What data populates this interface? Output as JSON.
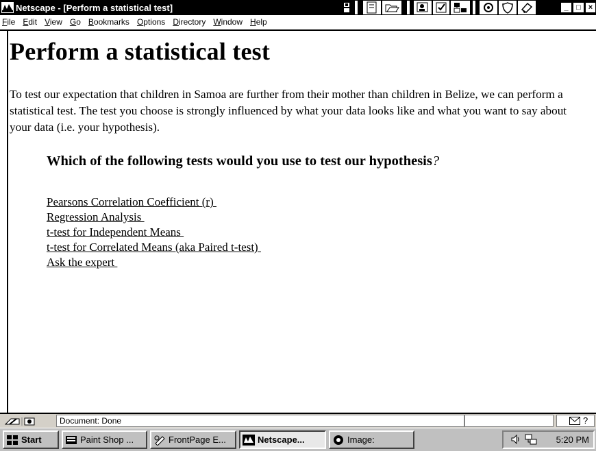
{
  "window": {
    "title": "Netscape - [Perform a statistical test]",
    "min_glyph": "_",
    "max_glyph": "□",
    "close_glyph": "×"
  },
  "menu": [
    {
      "accel": "F",
      "rest": "ile"
    },
    {
      "accel": "E",
      "rest": "dit"
    },
    {
      "accel": "V",
      "rest": "iew"
    },
    {
      "accel": "G",
      "rest": "o"
    },
    {
      "accel": "B",
      "rest": "ookmarks"
    },
    {
      "accel": "O",
      "rest": "ptions"
    },
    {
      "accel": "D",
      "rest": "irectory"
    },
    {
      "accel": "W",
      "rest": "indow"
    },
    {
      "accel": "H",
      "rest": "elp"
    }
  ],
  "page": {
    "title": "Perform a statistical test",
    "intro": "To test our expectation that children in Samoa are further from their mother than children in Belize, we can perform a statistical test. The test you choose is strongly influenced by what your data looks like and what you want to say about your data (i.e. your hypothesis).",
    "question": "Which of the following tests would you use to test our hypothesis",
    "question_mark": "?",
    "options": [
      "Pearsons Correlation Coefficient (r) ",
      "Regression Analysis ",
      "t-test for Independent Means ",
      "t-test for Correlated Means (aka Paired t-test) ",
      "Ask the expert "
    ]
  },
  "status": {
    "text": "Document: Done",
    "help_glyph": "?"
  },
  "taskbar": {
    "start": "Start",
    "items": [
      {
        "label": "Paint Shop ..."
      },
      {
        "label": "FrontPage E..."
      },
      {
        "label": "Netscape..."
      },
      {
        "label": "Image:"
      }
    ],
    "clock": "5:20 PM"
  },
  "colors": {
    "titlebar_bg": "#000000",
    "chrome_gray": "#c0c0c0",
    "page_bg": "#ffffff",
    "text": "#000000"
  }
}
